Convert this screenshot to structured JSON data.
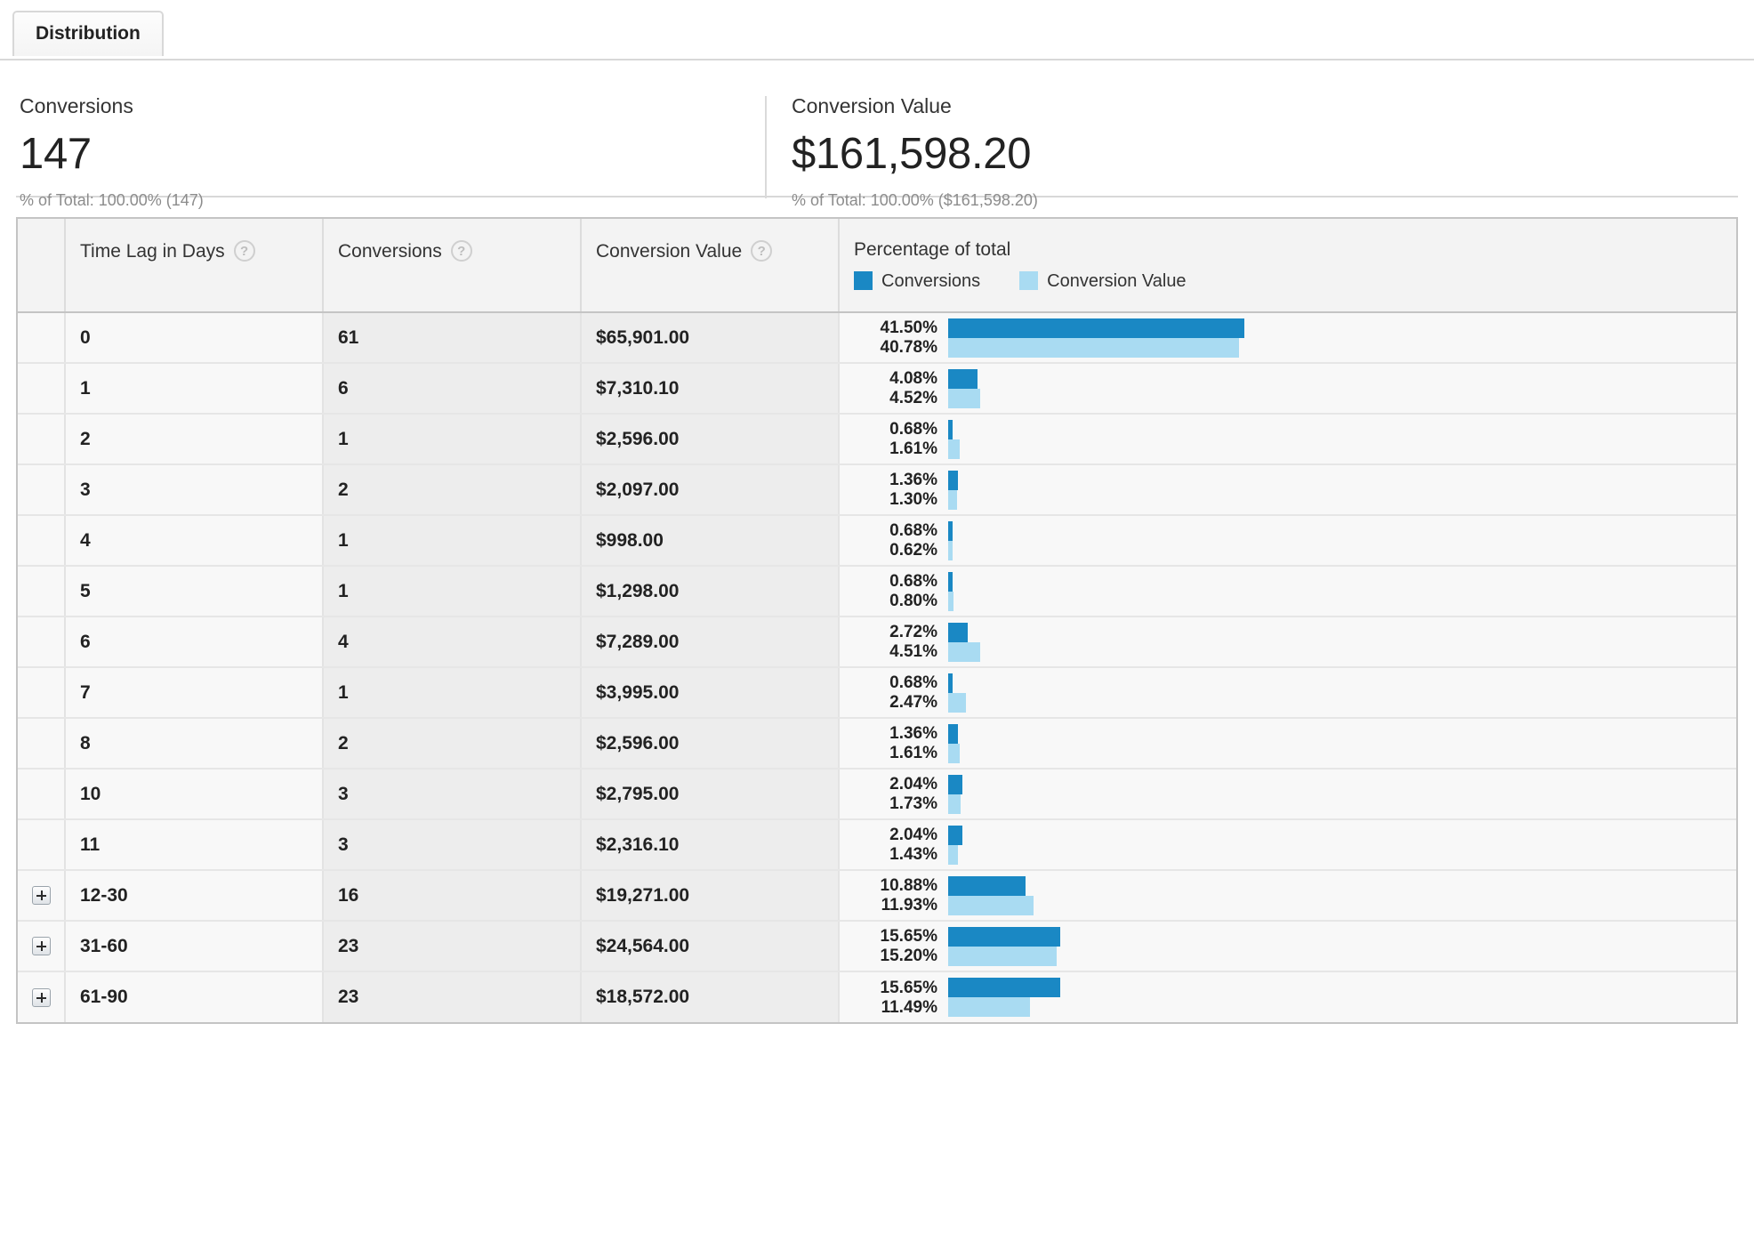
{
  "tabs": [
    {
      "label": "Distribution",
      "active": true
    }
  ],
  "summary": {
    "conversions": {
      "label": "Conversions",
      "value": "147",
      "sub": "% of Total: 100.00% (147)"
    },
    "conversion_value": {
      "label": "Conversion Value",
      "value": "$161,598.20",
      "sub": "% of Total: 100.00% ($161,598.20)"
    }
  },
  "table": {
    "columns": {
      "expander": "",
      "dimension": "Time Lag in Days",
      "conversions": "Conversions",
      "conversion_value": "Conversion Value",
      "percentage": "Percentage of total"
    },
    "help_icon": "?",
    "legend": [
      {
        "name": "Conversions",
        "color": "#1a88c4"
      },
      {
        "name": "Conversion Value",
        "color": "#a9dbf2"
      }
    ]
  },
  "colors": {
    "conversions_bar": "#1a88c4",
    "conversion_value_bar": "#a9dbf2",
    "header_bg": "#f3f3f3",
    "row_bg": "#f8f8f8",
    "numeric_bg": "#ededed"
  },
  "chart_data": {
    "type": "bar",
    "title": "Percentage of total",
    "xlabel": "",
    "ylabel": "Time Lag in Days",
    "xlim": [
      0,
      100
    ],
    "grid": false,
    "legend_position": "header",
    "categories": [
      "0",
      "1",
      "2",
      "3",
      "4",
      "5",
      "6",
      "7",
      "8",
      "10",
      "11",
      "12-30",
      "31-60",
      "61-90"
    ],
    "series": [
      {
        "name": "Conversions",
        "color": "#1a88c4",
        "values": [
          41.5,
          4.08,
          0.68,
          1.36,
          0.68,
          0.68,
          2.72,
          0.68,
          1.36,
          2.04,
          2.04,
          10.88,
          15.65,
          15.65
        ]
      },
      {
        "name": "Conversion Value",
        "color": "#a9dbf2",
        "values": [
          40.78,
          4.52,
          1.61,
          1.3,
          0.62,
          0.8,
          4.51,
          2.47,
          1.61,
          1.73,
          1.43,
          11.93,
          15.2,
          11.49
        ]
      }
    ]
  },
  "rows": [
    {
      "expandable": false,
      "dimension": "0",
      "conversions": "61",
      "conversion_value": "$65,901.00",
      "pct_conversions": "41.50%",
      "pct_conversion_value": "40.78%",
      "pct_conversions_num": 41.5,
      "pct_conversion_value_num": 40.78
    },
    {
      "expandable": false,
      "dimension": "1",
      "conversions": "6",
      "conversion_value": "$7,310.10",
      "pct_conversions": "4.08%",
      "pct_conversion_value": "4.52%",
      "pct_conversions_num": 4.08,
      "pct_conversion_value_num": 4.52
    },
    {
      "expandable": false,
      "dimension": "2",
      "conversions": "1",
      "conversion_value": "$2,596.00",
      "pct_conversions": "0.68%",
      "pct_conversion_value": "1.61%",
      "pct_conversions_num": 0.68,
      "pct_conversion_value_num": 1.61
    },
    {
      "expandable": false,
      "dimension": "3",
      "conversions": "2",
      "conversion_value": "$2,097.00",
      "pct_conversions": "1.36%",
      "pct_conversion_value": "1.30%",
      "pct_conversions_num": 1.36,
      "pct_conversion_value_num": 1.3
    },
    {
      "expandable": false,
      "dimension": "4",
      "conversions": "1",
      "conversion_value": "$998.00",
      "pct_conversions": "0.68%",
      "pct_conversion_value": "0.62%",
      "pct_conversions_num": 0.68,
      "pct_conversion_value_num": 0.62
    },
    {
      "expandable": false,
      "dimension": "5",
      "conversions": "1",
      "conversion_value": "$1,298.00",
      "pct_conversions": "0.68%",
      "pct_conversion_value": "0.80%",
      "pct_conversions_num": 0.68,
      "pct_conversion_value_num": 0.8
    },
    {
      "expandable": false,
      "dimension": "6",
      "conversions": "4",
      "conversion_value": "$7,289.00",
      "pct_conversions": "2.72%",
      "pct_conversion_value": "4.51%",
      "pct_conversions_num": 2.72,
      "pct_conversion_value_num": 4.51
    },
    {
      "expandable": false,
      "dimension": "7",
      "conversions": "1",
      "conversion_value": "$3,995.00",
      "pct_conversions": "0.68%",
      "pct_conversion_value": "2.47%",
      "pct_conversions_num": 0.68,
      "pct_conversion_value_num": 2.47
    },
    {
      "expandable": false,
      "dimension": "8",
      "conversions": "2",
      "conversion_value": "$2,596.00",
      "pct_conversions": "1.36%",
      "pct_conversion_value": "1.61%",
      "pct_conversions_num": 1.36,
      "pct_conversion_value_num": 1.61
    },
    {
      "expandable": false,
      "dimension": "10",
      "conversions": "3",
      "conversion_value": "$2,795.00",
      "pct_conversions": "2.04%",
      "pct_conversion_value": "1.73%",
      "pct_conversions_num": 2.04,
      "pct_conversion_value_num": 1.73
    },
    {
      "expandable": false,
      "dimension": "11",
      "conversions": "3",
      "conversion_value": "$2,316.10",
      "pct_conversions": "2.04%",
      "pct_conversion_value": "1.43%",
      "pct_conversions_num": 2.04,
      "pct_conversion_value_num": 1.43
    },
    {
      "expandable": true,
      "dimension": "12-30",
      "conversions": "16",
      "conversion_value": "$19,271.00",
      "pct_conversions": "10.88%",
      "pct_conversion_value": "11.93%",
      "pct_conversions_num": 10.88,
      "pct_conversion_value_num": 11.93
    },
    {
      "expandable": true,
      "dimension": "31-60",
      "conversions": "23",
      "conversion_value": "$24,564.00",
      "pct_conversions": "15.65%",
      "pct_conversion_value": "15.20%",
      "pct_conversions_num": 15.65,
      "pct_conversion_value_num": 15.2
    },
    {
      "expandable": true,
      "dimension": "61-90",
      "conversions": "23",
      "conversion_value": "$18,572.00",
      "pct_conversions": "15.65%",
      "pct_conversion_value": "11.49%",
      "pct_conversions_num": 15.65,
      "pct_conversion_value_num": 11.49
    }
  ]
}
